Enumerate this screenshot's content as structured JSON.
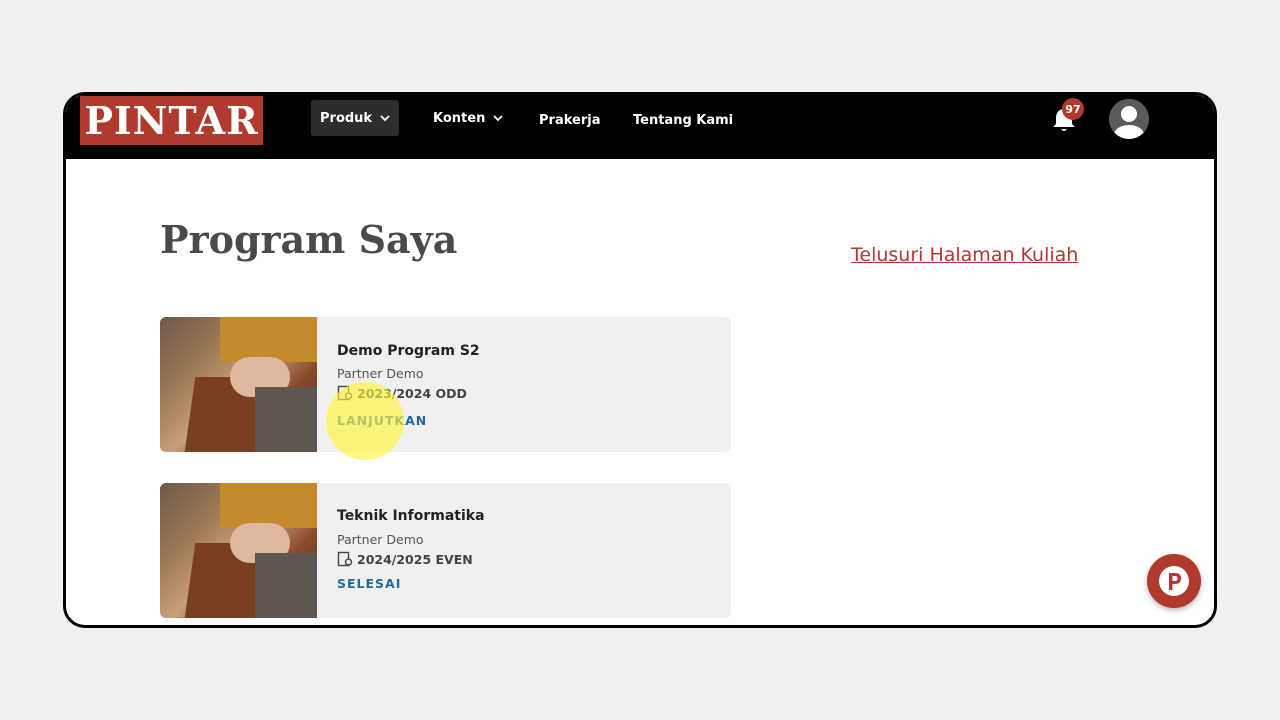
{
  "nav": {
    "logo": "PINTAR",
    "items": [
      {
        "label": "Produk",
        "has_dropdown": true,
        "active": true
      },
      {
        "label": "Konten",
        "has_dropdown": true,
        "active": false
      },
      {
        "label": "Prakerja",
        "has_dropdown": false,
        "active": false
      },
      {
        "label": "Tentang Kami",
        "has_dropdown": false,
        "active": false
      }
    ],
    "notification_count": "97"
  },
  "main": {
    "title": "Program Saya",
    "browse_link": "Telusuri Halaman Kuliah",
    "programs": [
      {
        "title": "Demo Program S2",
        "partner": "Partner Demo",
        "term": "2023/2024 ODD",
        "action": "LANJUTKAN"
      },
      {
        "title": "Teknik Informatika",
        "partner": "Partner Demo",
        "term": "2024/2025 EVEN",
        "action": "SELESAI"
      }
    ]
  },
  "colors": {
    "brand": "#b03a2e",
    "navbar": "#000000",
    "action": "#1f6aa5",
    "card_bg": "#f1f0ef"
  },
  "icons": {
    "notification": "bell-icon",
    "avatar": "user-icon",
    "term": "calendar-icon",
    "fab": "pintar-p-icon",
    "dropdown": "chevron-down-icon"
  }
}
